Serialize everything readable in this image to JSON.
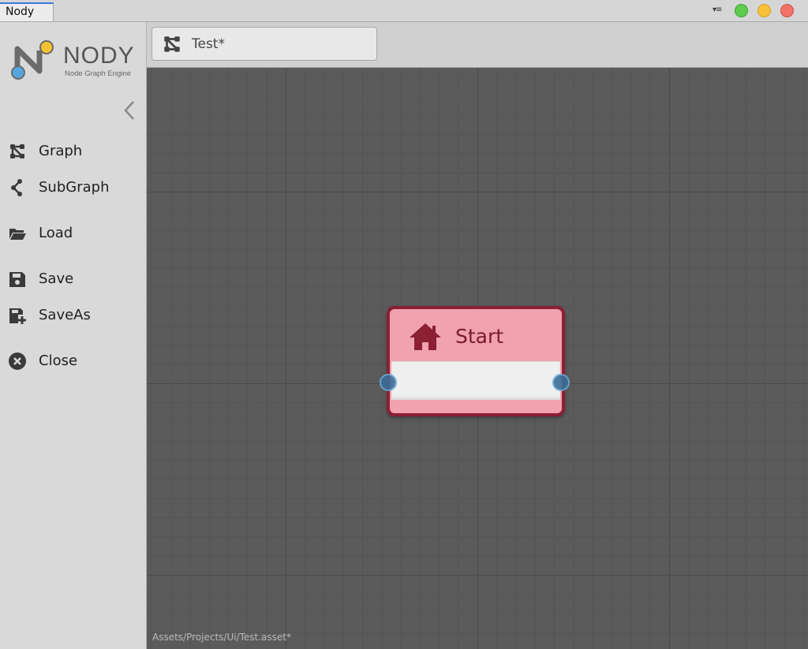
{
  "window": {
    "tab_title": "Nody"
  },
  "sidebar": {
    "logo": {
      "name": "NODY",
      "tagline": "Node Graph Engine"
    },
    "items": [
      {
        "label": "Graph",
        "icon": "graph-icon"
      },
      {
        "label": "SubGraph",
        "icon": "subgraph-icon"
      },
      {
        "label": "Load",
        "icon": "folder-open-icon"
      },
      {
        "label": "Save",
        "icon": "floppy-disk-icon"
      },
      {
        "label": "SaveAs",
        "icon": "save-as-icon"
      },
      {
        "label": "Close",
        "icon": "close-circle-icon"
      }
    ]
  },
  "graph_tab": {
    "label": "Test*"
  },
  "canvas": {
    "node": {
      "title": "Start",
      "icon": "home-icon"
    },
    "asset_path": "Assets/Projects/Ui/Test.asset*"
  },
  "colors": {
    "node_fill": "#f0a2ae",
    "node_border": "#8b1f33",
    "canvas_bg": "#5b5b5b",
    "socket": "#3b6e96"
  }
}
